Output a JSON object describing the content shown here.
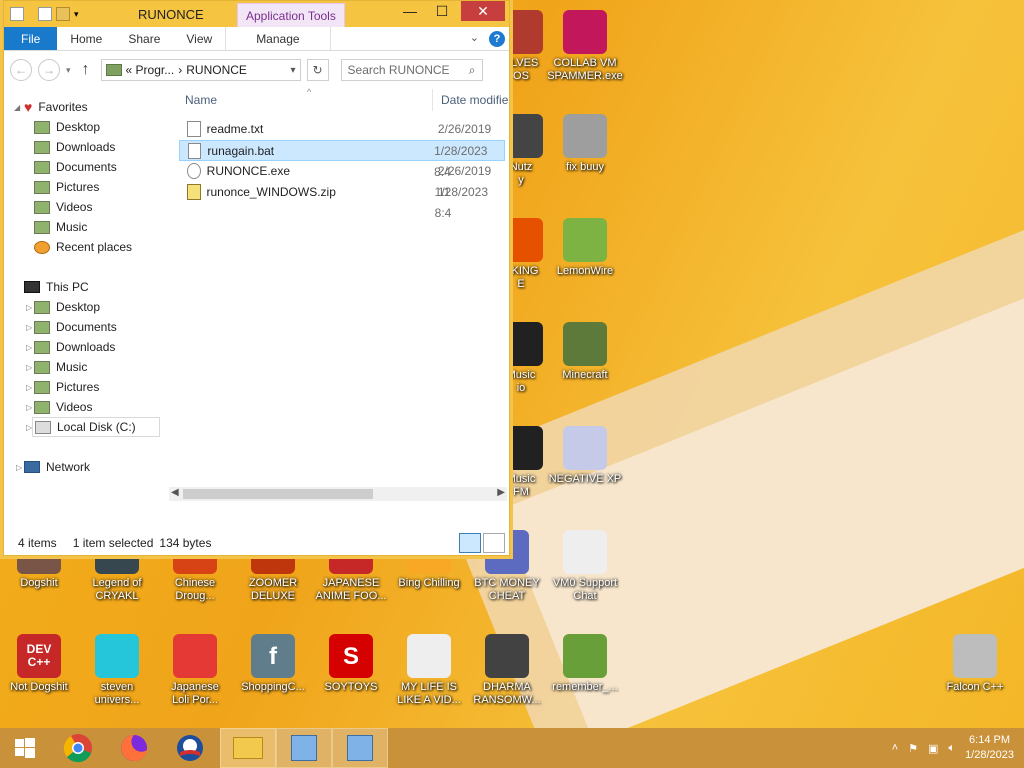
{
  "window": {
    "title": "RUNONCE",
    "application_tools": "Application Tools",
    "controls": {
      "minimize": "—",
      "maximize": "☐",
      "close": "✕"
    }
  },
  "ribbon": {
    "tabs": [
      "File",
      "Home",
      "Share",
      "View",
      "Manage"
    ],
    "help": "?"
  },
  "address_bar": {
    "path_prefix": "« Progr...",
    "path_sep": "›",
    "path_current": "RUNONCE",
    "search_placeholder": "Search RUNONCE"
  },
  "nav_pane": {
    "favorites_label": "Favorites",
    "favorites": [
      "Desktop",
      "Downloads",
      "Documents",
      "Pictures",
      "Videos",
      "Music",
      "Recent places"
    ],
    "this_pc_label": "This PC",
    "this_pc": [
      "Desktop",
      "Documents",
      "Downloads",
      "Music",
      "Pictures",
      "Videos",
      "Local Disk (C:)"
    ],
    "network_label": "Network"
  },
  "file_list": {
    "columns": {
      "name": "Name",
      "date": "Date modifie"
    },
    "files": [
      {
        "name": "readme.txt",
        "date": "2/26/2019 11"
      },
      {
        "name": "runagain.bat",
        "date": "1/28/2023 8:4",
        "selected": true
      },
      {
        "name": "RUNONCE.exe",
        "date": "2/26/2019 11"
      },
      {
        "name": "runonce_WINDOWS.zip",
        "date": "1/28/2023 8:4"
      }
    ]
  },
  "status": {
    "count": "4 items",
    "selected": "1 item selected",
    "size": "134 bytes"
  },
  "desktop_icons": [
    {
      "label": "ELVES\nOS",
      "color": "#b03a2e"
    },
    {
      "label": "COLLAB VM\nSPAMMER.exe",
      "color": "#c2185b"
    },
    {
      "label": "Nutz\ny",
      "color": "#444444"
    },
    {
      "label": "fix buuy",
      "color": "#9e9e9e"
    },
    {
      "label": "CKING\nE",
      "color": "#e65100"
    },
    {
      "label": "LemonWire",
      "color": "#7cb342"
    },
    {
      "label": "Music\nio",
      "color": "#212121"
    },
    {
      "label": "Minecraft",
      "color": "#5d7a3a"
    },
    {
      "label": "Music\nFM",
      "color": "#212121"
    },
    {
      "label": "NEGATIVE XP",
      "color": "#c5cae9"
    },
    {
      "label": "Dogshit",
      "color": "#795548"
    },
    {
      "label": "Legend of\nCRYAKL",
      "color": "#37474f"
    },
    {
      "label": "Chinese\nDroug...",
      "color": "#d84315"
    },
    {
      "label": "ZOOMER\nDELUXE",
      "color": "#bf360c"
    },
    {
      "label": "JAPANESE\nANIME FOO...",
      "color": "#c62828"
    },
    {
      "label": "Bing Chilling",
      "color": "#f9a825"
    },
    {
      "label": "BTC MONEY\nCHEAT",
      "color": "#5c6bc0"
    },
    {
      "label": "VM0 Support\nChat",
      "color": "#eeeeee"
    },
    {
      "label": "Not Dogshit",
      "color": "#c62828",
      "glyph": "DEV\nC++"
    },
    {
      "label": "steven\nunivers...",
      "color": "#26c6da"
    },
    {
      "label": "Japanese\nLoli Por...",
      "color": "#e53935"
    },
    {
      "label": "ShoppingC...",
      "color": "#607d8b",
      "glyph": "f"
    },
    {
      "label": "SOYTOYS",
      "color": "#d50000",
      "glyph": "S"
    },
    {
      "label": "MY LIFE IS\nLIKE A VID...",
      "color": "#eeeeee"
    },
    {
      "label": "DHARMA\nRANSOMW...",
      "color": "#424242"
    },
    {
      "label": "remember_...",
      "color": "#689f38"
    },
    {
      "label": "Falcon C++",
      "color": "#bdbdbd"
    }
  ],
  "taskbar": {
    "clock_time": "6:14 PM",
    "clock_date": "1/28/2023"
  }
}
